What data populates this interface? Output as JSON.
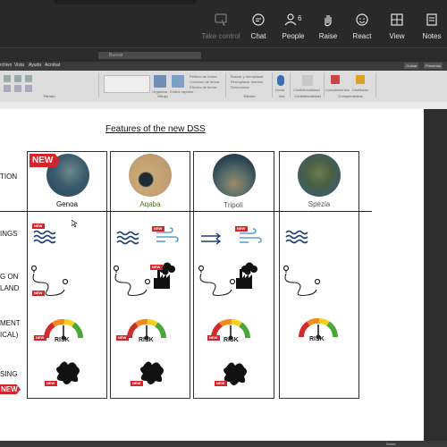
{
  "meeting_bar": {
    "take_control": "Take control",
    "chat": "Chat",
    "people": "People",
    "people_count": "6",
    "raise": "Raise",
    "react": "React",
    "view": "View",
    "notes": "Notes"
  },
  "menubar": {
    "items": [
      "rchivo",
      "Vista",
      "Ayuda",
      "Acrobat"
    ],
    "search_placeholder": "Buscar",
    "window_buttons": [
      "Grabar",
      "Presentar"
    ]
  },
  "ribbon": {
    "groups": [
      "Párrafo",
      "Dibujo",
      "Edición",
      "Voz",
      "Confidencialidad",
      "Complementos"
    ],
    "items": [
      "Organizar",
      "Estilos rápidos",
      "Relleno de forma",
      "Contorno de forma",
      "Efectos de forma",
      "Buscar y reemplazar",
      "Reemplazar fuentes",
      "Seleccionar",
      "Dictar",
      "Confidencialidad",
      "Complementos",
      "Diseñador"
    ]
  },
  "slide": {
    "title": "Features of the new DSS",
    "row_labels": {
      "location": "TION",
      "warnings": "INGS",
      "routing_line1": "G ON",
      "routing_line2": "LAND",
      "risk_line1": "MENT",
      "risk_line2": "ICAL)",
      "spill": "SING"
    },
    "ports": [
      {
        "name": "Genoa",
        "color": "#111111"
      },
      {
        "name": "Aqaba",
        "color": "#4a7a1e"
      },
      {
        "name": "Tripoli",
        "color": "#555555"
      },
      {
        "name": "Spezia",
        "color": "#555555"
      }
    ],
    "new_label": "NEW",
    "risk_label": "RISK",
    "gauge_labels": [
      "LOW",
      "MEDIUM",
      "HIGH"
    ]
  },
  "statusbar": {
    "notes": "Notas"
  },
  "colors": {
    "new_tag": "#d8232a",
    "meeting_bar": "#292929",
    "ribbon": "#dcdcdc"
  }
}
